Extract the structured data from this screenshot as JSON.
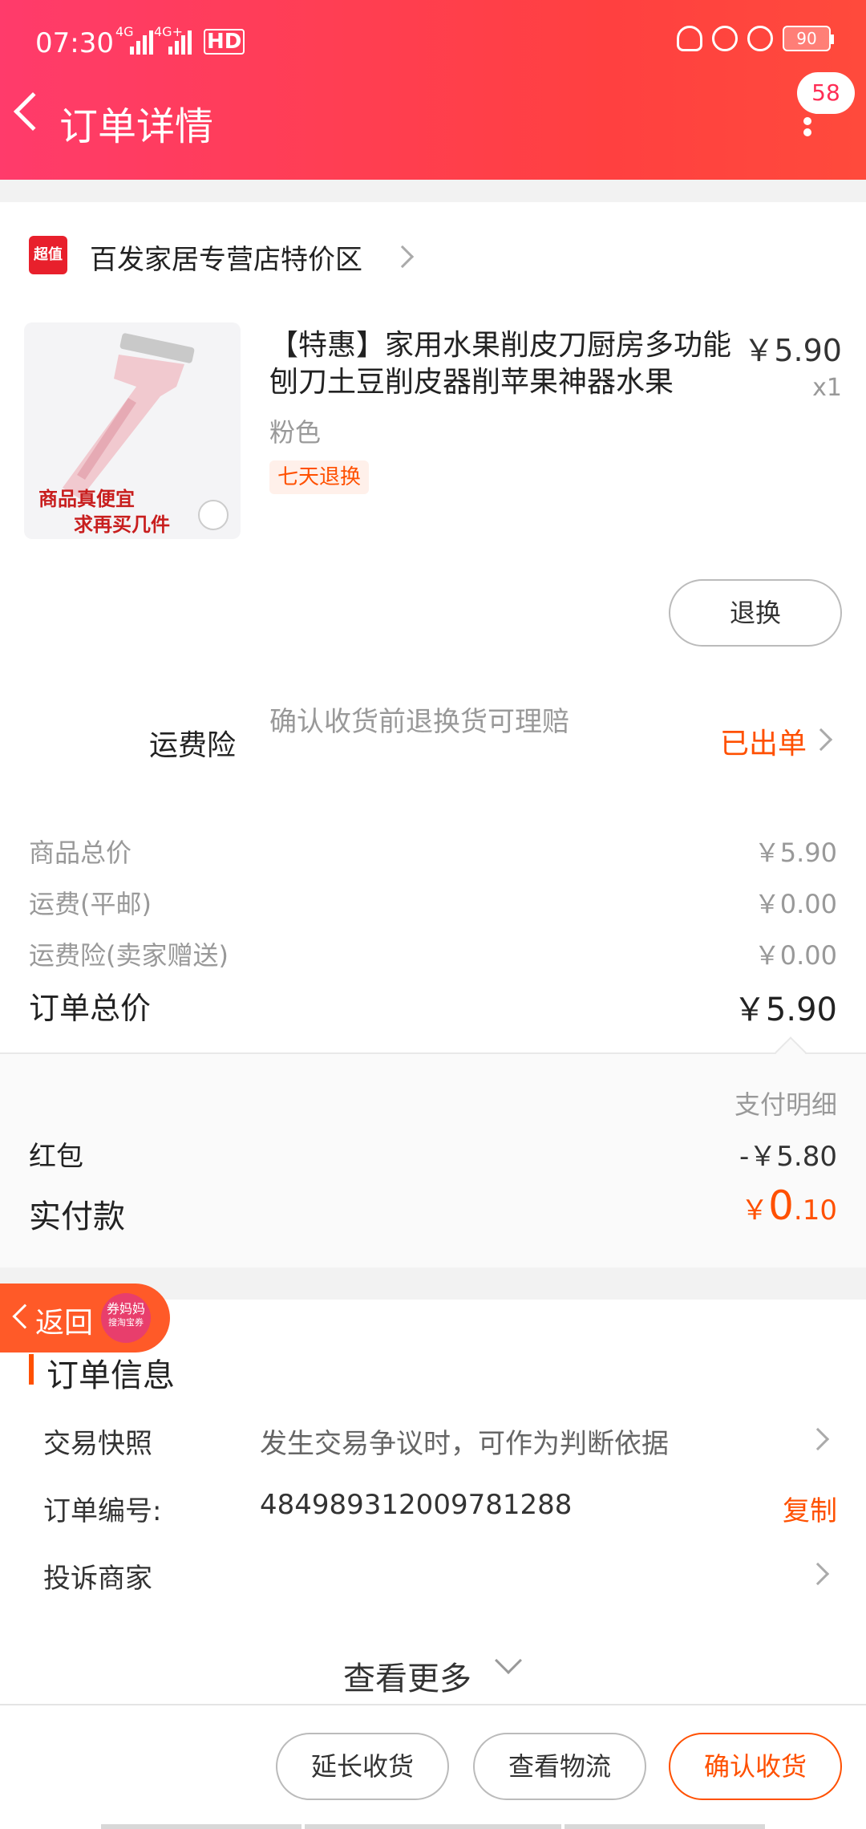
{
  "status_bar": {
    "time": "07:30",
    "network1": "4G",
    "network2": "4G+",
    "hd": "HD",
    "battery": "90"
  },
  "header": {
    "title": "订单详情",
    "message_count": "58"
  },
  "shop": {
    "badge": "超值",
    "name": "百发家居专营店特价区"
  },
  "product": {
    "title": "【特惠】家用水果削皮刀厨房多功能刨刀土豆削皮器削苹果神器水果",
    "price": "￥5.90",
    "quantity": "x1",
    "sku": "粉色",
    "tag": "七天退换",
    "image_caption_1": "商品真便宜",
    "image_caption_2": "求再买几件",
    "return_button": "退换"
  },
  "insurance": {
    "label": "运费险",
    "description": "确认收货前退换货可理赔",
    "status": "已出单"
  },
  "fees": {
    "items": [
      {
        "label": "商品总价",
        "value": "￥5.90"
      },
      {
        "label": "运费(平邮)",
        "value": "￥0.00"
      },
      {
        "label": "运费险(卖家赠送)",
        "value": "￥0.00"
      }
    ],
    "total_label": "订单总价",
    "total_value": "￥5.90"
  },
  "payment": {
    "detail_label": "支付明细",
    "hongbao_label": "红包",
    "hongbao_value": "-￥5.80",
    "paid_label": "实付款",
    "paid_currency": "￥",
    "paid_integer": "0",
    "paid_decimal": ".10"
  },
  "order_info": {
    "title": "订单信息",
    "snapshot_label": "交易快照",
    "snapshot_value": "发生交易争议时，可作为判断依据",
    "order_no_label": "订单编号:",
    "order_no_value": "484989312009781288",
    "copy_label": "复制",
    "complain_label": "投诉商家",
    "see_more": "查看更多"
  },
  "floating": {
    "back_label": "返回",
    "coupon_name": "券妈妈",
    "coupon_sub": "搜淘宝券"
  },
  "actions": {
    "extend": "延长收货",
    "logistics": "查看物流",
    "confirm": "确认收货"
  },
  "colors": {
    "header_start": "#ff3b6b",
    "header_end": "#ff4040",
    "accent": "#ff5000"
  }
}
